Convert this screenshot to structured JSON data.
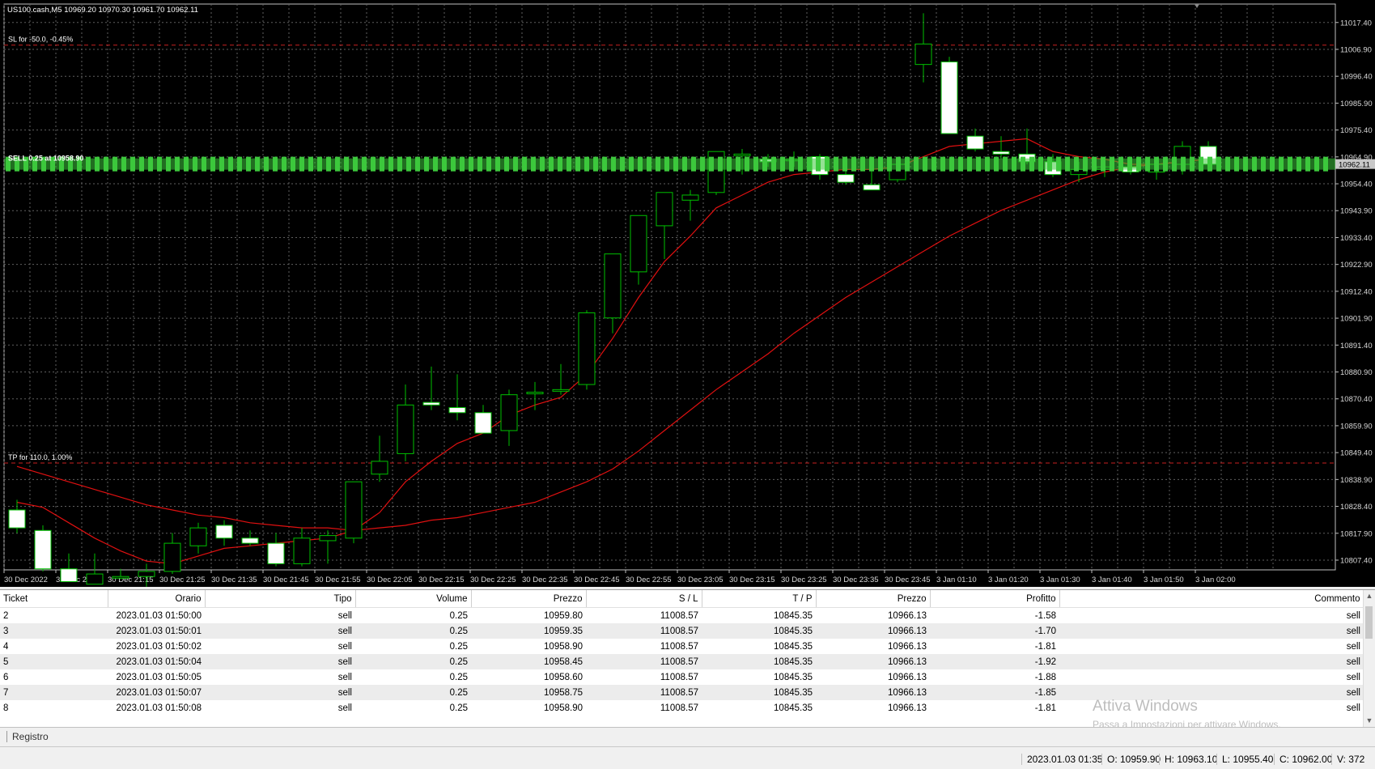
{
  "chart": {
    "info": "US100.cash,M5  10969.20 10970.30 10961.70 10962.11",
    "sl_label": "SL for -50.0, -0.45%",
    "tp_label": "TP for 110.0, 1.00%",
    "order_label": "SELL 0.25 at 10958.90",
    "price_tag": "10962.11",
    "colors": {
      "background": "#000000",
      "grid": "#5f5f5f",
      "bull": "#000000",
      "bear": "#ffffff",
      "candle_outline": "#00c000",
      "ma": "#e01010",
      "level": "#c82020",
      "orders": "#3cc83c"
    },
    "price_axis": [
      "11017.40",
      "11006.90",
      "10996.40",
      "10985.90",
      "10975.40",
      "10964.90",
      "10954.40",
      "10943.90",
      "10933.40",
      "10922.90",
      "10912.40",
      "10901.90",
      "10891.40",
      "10880.90",
      "10870.40",
      "10859.90",
      "10849.40",
      "10838.90",
      "10828.40",
      "10817.90",
      "10807.40"
    ],
    "time_axis": [
      "30 Dec 2022",
      "30 Dec 21:05",
      "30 Dec 21:15",
      "30 Dec 21:25",
      "30 Dec 21:35",
      "30 Dec 21:45",
      "30 Dec 21:55",
      "30 Dec 22:05",
      "30 Dec 22:15",
      "30 Dec 22:25",
      "30 Dec 22:35",
      "30 Dec 22:45",
      "30 Dec 22:55",
      "30 Dec 23:05",
      "30 Dec 23:15",
      "30 Dec 23:25",
      "30 Dec 23:35",
      "30 Dec 23:45",
      "3 Jan 01:10",
      "3 Jan 01:20",
      "3 Jan 01:30",
      "3 Jan 01:40",
      "3 Jan 01:50",
      "3 Jan 02:00"
    ]
  },
  "chart_data": {
    "type": "candlestick",
    "title": "US100.cash,M5",
    "ylim": [
      10803.6,
      11024.6
    ],
    "levels": {
      "stop_loss": 11008.57,
      "take_profit": 10845.35,
      "open_orders": 10962.11
    },
    "candles": [
      {
        "o": 10827,
        "h": 10831,
        "l": 10818,
        "c": 10820
      },
      {
        "o": 10819,
        "h": 10821,
        "l": 10803,
        "c": 10804
      },
      {
        "o": 10804,
        "h": 10810,
        "l": 10799,
        "c": 10799
      },
      {
        "o": 10798,
        "h": 10810,
        "l": 10798,
        "c": 10802
      },
      {
        "o": 10801,
        "h": 10804,
        "l": 10800,
        "c": 10801
      },
      {
        "o": 10801,
        "h": 10806,
        "l": 10797,
        "c": 10803
      },
      {
        "o": 10803,
        "h": 10818,
        "l": 10802,
        "c": 10814
      },
      {
        "o": 10813,
        "h": 10822,
        "l": 10810,
        "c": 10820
      },
      {
        "o": 10821,
        "h": 10823,
        "l": 10813,
        "c": 10816
      },
      {
        "o": 10816,
        "h": 10819,
        "l": 10813,
        "c": 10814
      },
      {
        "o": 10814,
        "h": 10818,
        "l": 10805,
        "c": 10806
      },
      {
        "o": 10806,
        "h": 10820,
        "l": 10805,
        "c": 10816
      },
      {
        "o": 10815,
        "h": 10819,
        "l": 10806,
        "c": 10817
      },
      {
        "o": 10816,
        "h": 10838,
        "l": 10814,
        "c": 10838
      },
      {
        "o": 10841,
        "h": 10856,
        "l": 10838,
        "c": 10846
      },
      {
        "o": 10849,
        "h": 10876,
        "l": 10846,
        "c": 10868
      },
      {
        "o": 10869,
        "h": 10883,
        "l": 10866,
        "c": 10868
      },
      {
        "o": 10867,
        "h": 10880,
        "l": 10862,
        "c": 10865
      },
      {
        "o": 10865,
        "h": 10868,
        "l": 10857,
        "c": 10857
      },
      {
        "o": 10858,
        "h": 10874,
        "l": 10852,
        "c": 10872
      },
      {
        "o": 10873,
        "h": 10877,
        "l": 10866,
        "c": 10873
      },
      {
        "o": 10874,
        "h": 10884,
        "l": 10872,
        "c": 10874
      },
      {
        "o": 10876,
        "h": 10905,
        "l": 10874,
        "c": 10904
      },
      {
        "o": 10902,
        "h": 10927,
        "l": 10896,
        "c": 10927
      },
      {
        "o": 10920,
        "h": 10942,
        "l": 10915,
        "c": 10942
      },
      {
        "o": 10938,
        "h": 10951,
        "l": 10925,
        "c": 10951
      },
      {
        "o": 10948,
        "h": 10952,
        "l": 10940,
        "c": 10950
      },
      {
        "o": 10951,
        "h": 10967,
        "l": 10950,
        "c": 10967
      },
      {
        "o": 10966,
        "h": 10968,
        "l": 10958,
        "c": 10966
      },
      {
        "o": 10964,
        "h": 10966,
        "l": 10961,
        "c": 10963
      },
      {
        "o": 10964,
        "h": 10967,
        "l": 10961,
        "c": 10964
      },
      {
        "o": 10965,
        "h": 10966,
        "l": 10956,
        "c": 10958
      },
      {
        "o": 10958,
        "h": 10962,
        "l": 10954,
        "c": 10955
      },
      {
        "o": 10954,
        "h": 10960,
        "l": 10952,
        "c": 10952
      },
      {
        "o": 10956,
        "h": 10964,
        "l": 10955,
        "c": 10962
      },
      {
        "o": 11001,
        "h": 11021,
        "l": 10994,
        "c": 11009
      },
      {
        "o": 11002,
        "h": 11004,
        "l": 10974,
        "c": 10974
      },
      {
        "o": 10973,
        "h": 10976,
        "l": 10967,
        "c": 10968
      },
      {
        "o": 10967,
        "h": 10973,
        "l": 10964,
        "c": 10966
      },
      {
        "o": 10966,
        "h": 10976,
        "l": 10962,
        "c": 10963
      },
      {
        "o": 10963,
        "h": 10966,
        "l": 10957,
        "c": 10958
      },
      {
        "o": 10958,
        "h": 10963,
        "l": 10955,
        "c": 10960
      },
      {
        "o": 10960,
        "h": 10964,
        "l": 10957,
        "c": 10961
      },
      {
        "o": 10961,
        "h": 10963,
        "l": 10958,
        "c": 10959
      },
      {
        "o": 10959,
        "h": 10963,
        "l": 10956,
        "c": 10962
      },
      {
        "o": 10962,
        "h": 10971,
        "l": 10958,
        "c": 10969
      },
      {
        "o": 10969,
        "h": 10971,
        "l": 10961,
        "c": 10962
      }
    ],
    "ma_fast": [
      10830,
      10828,
      10822,
      10816,
      10811,
      10807,
      10806,
      10809,
      10812,
      10813,
      10814,
      10815,
      10816,
      10819,
      10826,
      10838,
      10846,
      10853,
      10857,
      10864,
      10868,
      10871,
      10880,
      10894,
      10910,
      10924,
      10934,
      10945,
      10950,
      10955,
      10958,
      10959,
      10960,
      10960,
      10961,
      10965,
      10969,
      10970,
      10971,
      10972,
      10967,
      10965,
      10964,
      10962,
      10962,
      10963,
      10964
    ],
    "ma_slow": [
      10844,
      10841,
      10838,
      10835,
      10832,
      10829,
      10827,
      10825,
      10824,
      10822,
      10821,
      10820,
      10820,
      10819,
      10820,
      10821,
      10823,
      10824,
      10826,
      10828,
      10830,
      10834,
      10838,
      10843,
      10850,
      10858,
      10866,
      10874,
      10881,
      10888,
      10896,
      10903,
      10910,
      10916,
      10922,
      10928,
      10934,
      10939,
      10944,
      10948,
      10952,
      10956,
      10959,
      10961,
      10962,
      10963,
      10964
    ]
  },
  "table": {
    "headers": [
      "Ticket",
      "Orario",
      "Tipo",
      "Volume",
      "Prezzo",
      "S / L",
      "T / P",
      "Prezzo",
      "Profitto",
      "Commento"
    ],
    "rows": [
      [
        "2",
        "2023.01.03 01:50:00",
        "sell",
        "0.25",
        "10959.80",
        "11008.57",
        "10845.35",
        "10966.13",
        "-1.58",
        "sell"
      ],
      [
        "3",
        "2023.01.03 01:50:01",
        "sell",
        "0.25",
        "10959.35",
        "11008.57",
        "10845.35",
        "10966.13",
        "-1.70",
        "sell"
      ],
      [
        "4",
        "2023.01.03 01:50:02",
        "sell",
        "0.25",
        "10958.90",
        "11008.57",
        "10845.35",
        "10966.13",
        "-1.81",
        "sell"
      ],
      [
        "5",
        "2023.01.03 01:50:04",
        "sell",
        "0.25",
        "10958.45",
        "11008.57",
        "10845.35",
        "10966.13",
        "-1.92",
        "sell"
      ],
      [
        "6",
        "2023.01.03 01:50:05",
        "sell",
        "0.25",
        "10958.60",
        "11008.57",
        "10845.35",
        "10966.13",
        "-1.88",
        "sell"
      ],
      [
        "7",
        "2023.01.03 01:50:07",
        "sell",
        "0.25",
        "10958.75",
        "11008.57",
        "10845.35",
        "10966.13",
        "-1.85",
        "sell"
      ],
      [
        "8",
        "2023.01.03 01:50:08",
        "sell",
        "0.25",
        "10958.90",
        "11008.57",
        "10845.35",
        "10966.13",
        "-1.81",
        "sell"
      ]
    ]
  },
  "tabs": {
    "journal": "Registro"
  },
  "status": {
    "time": "2023.01.03 01:35",
    "open": "O: 10959.90",
    "high": "H: 10963.10",
    "low": "L: 10955.40",
    "close": "C: 10962.00",
    "volume": "V: 372"
  },
  "watermark": {
    "title": "Attiva Windows",
    "subtitle": "Passa a Impostazioni per attivare Windows."
  }
}
